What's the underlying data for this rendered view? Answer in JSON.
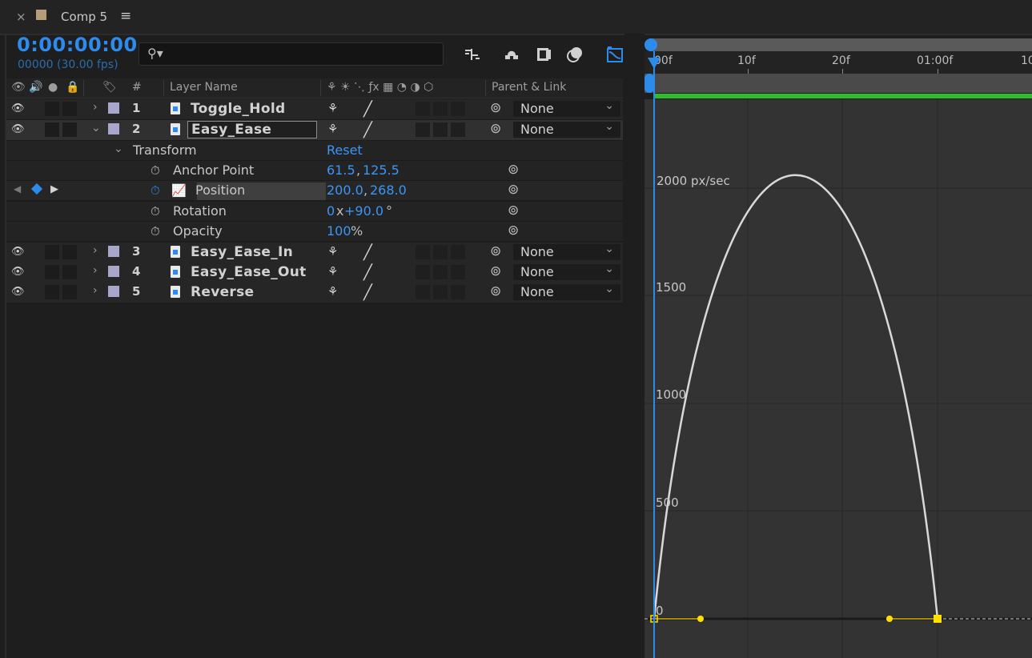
{
  "tab": {
    "close": "×",
    "title": "Comp 5",
    "menu": "≡",
    "swatch_color": "#b59d79"
  },
  "timecode": {
    "value": "0:00:00:00",
    "frames": "00000 (30.00 fps)"
  },
  "search": {
    "icon": "search-icon",
    "placeholder": ""
  },
  "columns": {
    "number": "#",
    "layer_name": "Layer Name",
    "parent": "Parent & Link"
  },
  "layers": [
    {
      "num": "1",
      "name": "Toggle_Hold",
      "parent": "None",
      "expanded": false
    },
    {
      "num": "2",
      "name": "Easy_Ease",
      "parent": "None",
      "expanded": true
    },
    {
      "num": "3",
      "name": "Easy_Ease_In",
      "parent": "None",
      "expanded": false
    },
    {
      "num": "4",
      "name": "Easy_Ease_Out",
      "parent": "None",
      "expanded": false
    },
    {
      "num": "5",
      "name": "Reverse",
      "parent": "None",
      "expanded": false
    }
  ],
  "transform": {
    "label": "Transform",
    "reset": "Reset",
    "anchor": {
      "name": "Anchor Point",
      "x": "61.5",
      "y": "125.5"
    },
    "position": {
      "name": "Position",
      "x": "200.0",
      "y": "268.0"
    },
    "rotation": {
      "name": "Rotation",
      "turns": "0",
      "x": "x",
      "deg": "+90.0",
      "unit": "°"
    },
    "opacity": {
      "name": "Opacity",
      "value": "100",
      "unit": "%"
    }
  },
  "ruler": {
    "ticks": [
      "00f",
      "10f",
      "20f",
      "01:00f",
      "10"
    ]
  },
  "graph": {
    "unit_label": "2000 px/sec",
    "y_labels": [
      "1500",
      "1000",
      "500",
      "0"
    ],
    "curve_color": "#d9d9d9",
    "keyframe_color": "#ffe000",
    "playhead_color": "#2d8ceb"
  }
}
